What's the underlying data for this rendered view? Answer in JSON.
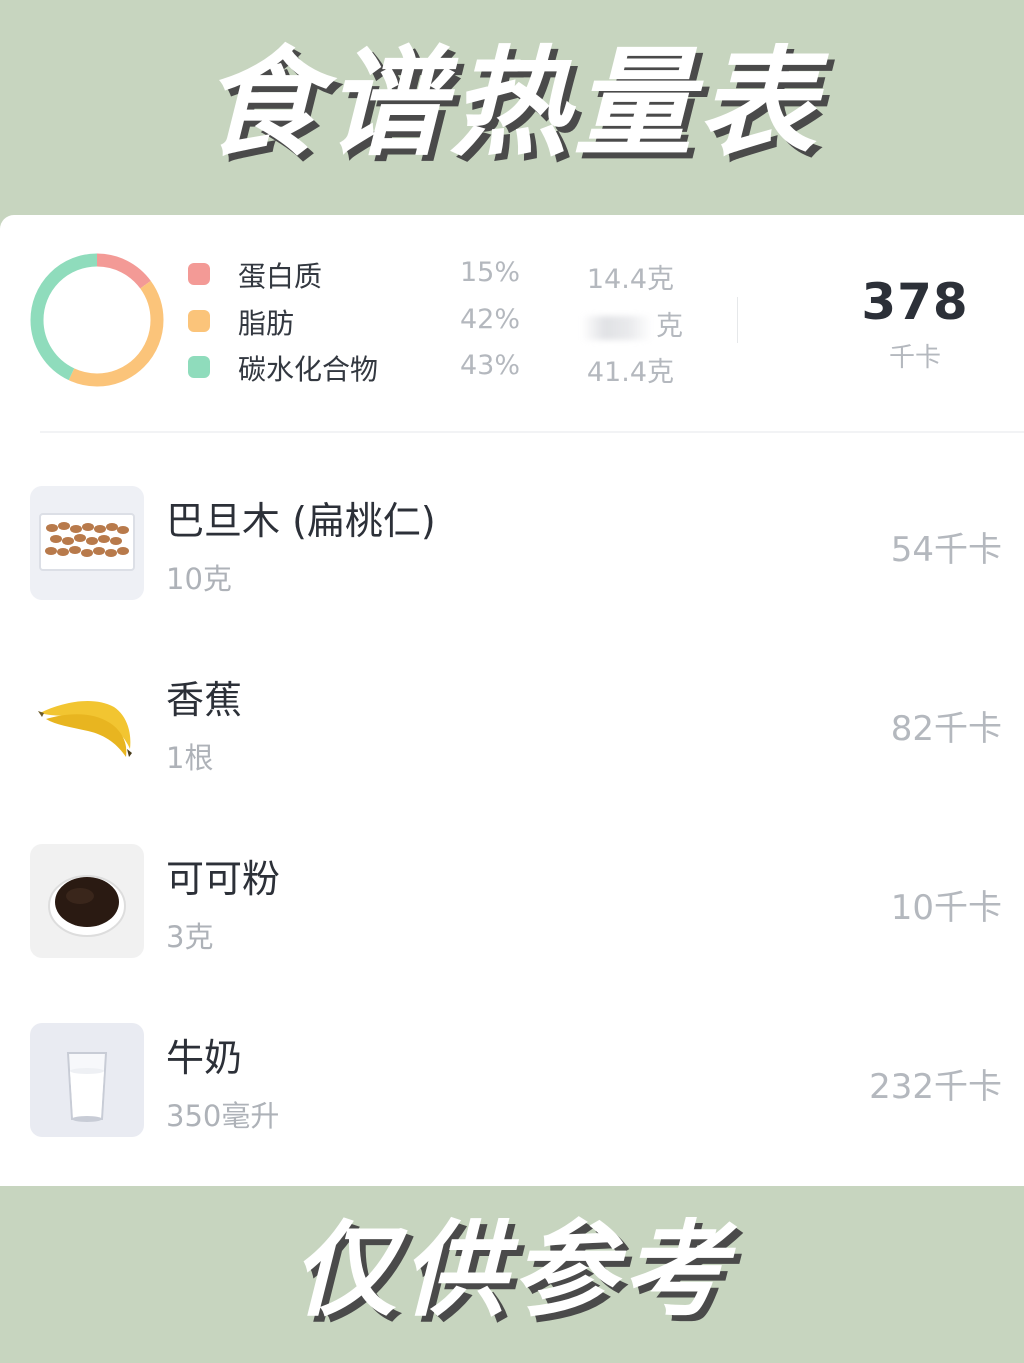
{
  "header": {
    "title": "食谱热量表"
  },
  "footer": {
    "text": "仅供参考"
  },
  "summary": {
    "macros": [
      {
        "name": "蛋白质",
        "percent": "15%",
        "amount": "14.4克",
        "color": "#f39a96"
      },
      {
        "name": "脂肪",
        "percent": "42%",
        "amount": "克",
        "color": "#fbc47a"
      },
      {
        "name": "碳水化合物",
        "percent": "43%",
        "amount": "41.4克",
        "color": "#8fdcbc"
      }
    ],
    "total_calories": "378",
    "total_unit": "千卡"
  },
  "foods": [
    {
      "name": "巴旦木 (扁桃仁)",
      "quantity": "10克",
      "calories": "54千卡",
      "icon": "almond-icon"
    },
    {
      "name": "香蕉",
      "quantity": "1根",
      "calories": "82千卡",
      "icon": "banana-icon"
    },
    {
      "name": "可可粉",
      "quantity": "3克",
      "calories": "10千卡",
      "icon": "cocoa-powder-icon"
    },
    {
      "name": "牛奶",
      "quantity": "350毫升",
      "calories": "232千卡",
      "icon": "milk-glass-icon"
    }
  ]
}
